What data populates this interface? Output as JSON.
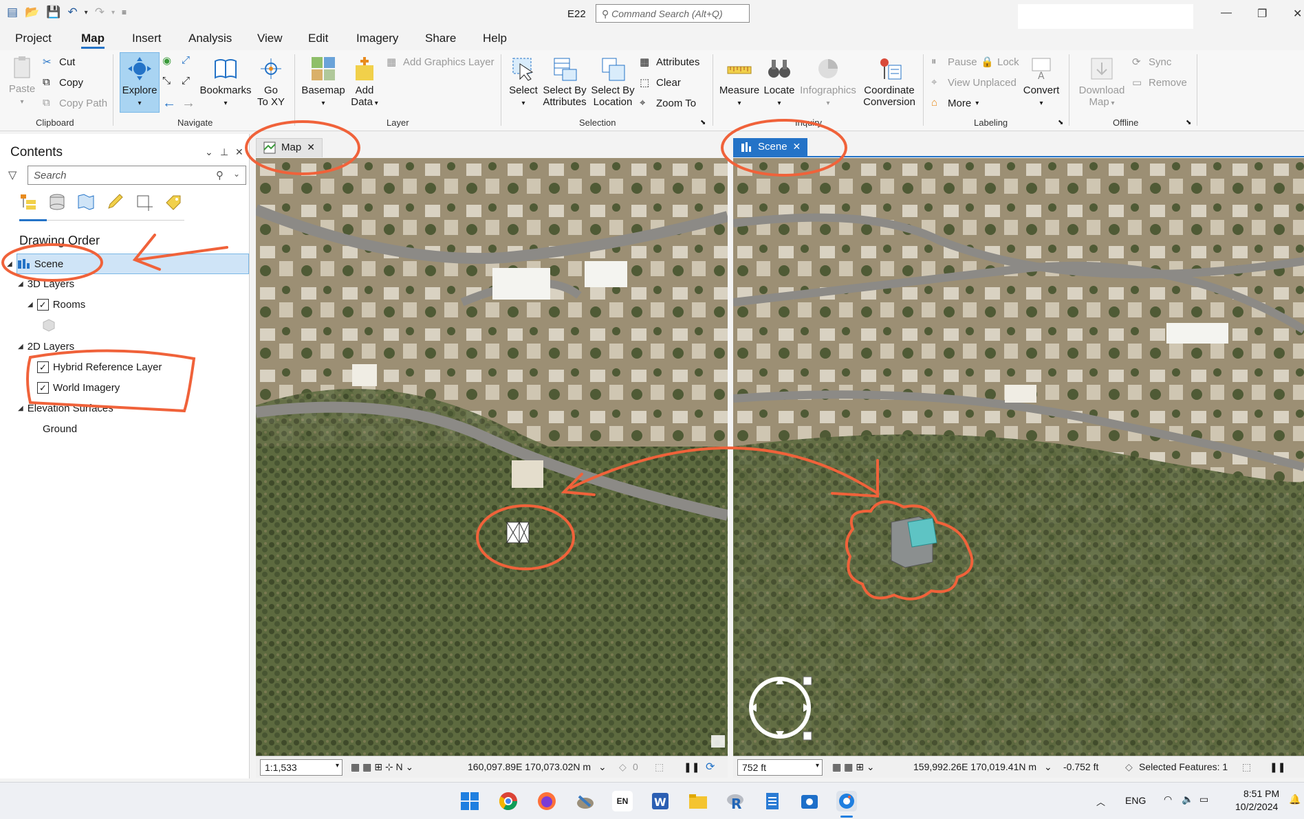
{
  "window": {
    "title": "E22",
    "command_search_placeholder": "Command Search (Alt+Q)"
  },
  "menu": {
    "tabs": [
      "Project",
      "Map",
      "Insert",
      "Analysis",
      "View",
      "Edit",
      "Imagery",
      "Share",
      "Help"
    ],
    "active": "Map"
  },
  "ribbon": {
    "clipboard": {
      "label": "Clipboard",
      "paste": "Paste",
      "cut": "Cut",
      "copy": "Copy",
      "copy_path": "Copy Path"
    },
    "navigate": {
      "label": "Navigate",
      "explore": "Explore",
      "bookmarks": "Bookmarks",
      "go_to_xy_1": "Go",
      "go_to_xy_2": "To XY"
    },
    "layer": {
      "label": "Layer",
      "basemap": "Basemap",
      "add_data_1": "Add",
      "add_data_2": "Data",
      "add_graphics_layer": "Add Graphics Layer"
    },
    "selection": {
      "label": "Selection",
      "select": "Select",
      "select_by_attr_1": "Select By",
      "select_by_attr_2": "Attributes",
      "select_by_loc_1": "Select By",
      "select_by_loc_2": "Location",
      "attributes": "Attributes",
      "clear": "Clear",
      "zoom_to": "Zoom To"
    },
    "inquiry": {
      "label": "Inquiry",
      "measure": "Measure",
      "locate": "Locate",
      "infographics": "Infographics",
      "coord_conv_1": "Coordinate",
      "coord_conv_2": "Conversion"
    },
    "labeling": {
      "label": "Labeling",
      "pause": "Pause",
      "lock": "Lock",
      "view_unplaced": "View Unplaced",
      "more": "More",
      "convert": "Convert"
    },
    "offline": {
      "label": "Offline",
      "download_map_1": "Download",
      "download_map_2": "Map",
      "sync": "Sync",
      "remove": "Remove"
    }
  },
  "contents": {
    "title": "Contents",
    "search_placeholder": "Search",
    "drawing_order": "Drawing Order",
    "tree": {
      "scene": "Scene",
      "layers_3d": "3D Layers",
      "rooms": "Rooms",
      "layers_2d": "2D Layers",
      "hybrid_reference": "Hybrid Reference Layer",
      "world_imagery": "World Imagery",
      "elevation_surfaces": "Elevation Surfaces",
      "ground": "Ground"
    }
  },
  "views": {
    "map_tab": "Map",
    "scene_tab": "Scene"
  },
  "map_status": {
    "scale": "1:1,533",
    "coordinates": "160,097.89E 170,073.02N m",
    "selected_count": "0"
  },
  "scene_status": {
    "scale": "752 ft",
    "coordinates": "159,992.26E 170,019.41N m",
    "elevation": "-0.752 ft",
    "selected_features": "Selected Features: 1"
  },
  "taskbar": {
    "lang": "ENG",
    "time": "8:51 PM",
    "date": "10/2/2024",
    "en_badge": "EN"
  },
  "colors": {
    "accent": "#2473c7",
    "annotation": "#f0623a",
    "scene_tab_bg": "#2473c7"
  }
}
